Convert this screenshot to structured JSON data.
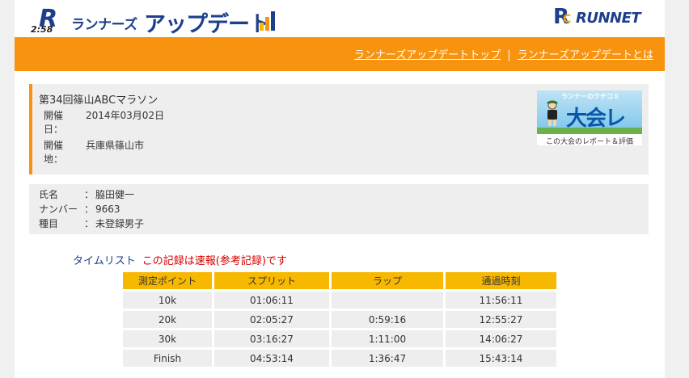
{
  "header": {
    "logo_mark": "R",
    "logo_sub": "2:58",
    "logo_small": "ランナーズ",
    "logo_big": "アップデート",
    "runnet_text": "RUNNET",
    "runnet_mark_r": "R",
    "runnet_mark_c": "C"
  },
  "nav": {
    "top_link": "ランナーズアップデートトップ",
    "separator": "|",
    "about_link": "ランナーズアップデートとは"
  },
  "race": {
    "title": "第34回篠山ABCマラソン",
    "date_label": "開催日：",
    "date_value": "2014年03月02日",
    "place_label": "開催地：",
    "place_value": "兵庫県篠山市",
    "banner_tag": "ランナーのクチコミ",
    "banner_big": "大会レポ",
    "banner_caption": "この大会のレポート＆評価"
  },
  "runner": {
    "name_label": "氏名",
    "name_value": "脇田健一",
    "number_label": "ナンバー",
    "number_value": "9663",
    "category_label": "種目",
    "category_value": "未登録男子",
    "colon": "："
  },
  "timelist": {
    "title": "タイムリスト",
    "notice": "この記録は速報(参考記録)です",
    "headers": [
      "測定ポイント",
      "スプリット",
      "ラップ",
      "通過時刻"
    ],
    "rows": [
      [
        "10k",
        "01:06:11",
        "",
        "11:56:11"
      ],
      [
        "20k",
        "02:05:27",
        "0:59:16",
        "12:55:27"
      ],
      [
        "30k",
        "03:16:27",
        "1:11:00",
        "14:06:27"
      ],
      [
        "Finish",
        "04:53:14",
        "1:36:47",
        "15:43:14"
      ]
    ]
  },
  "colors": {
    "orange": "#f7930f",
    "navy": "#1e3f8c",
    "header_cell": "#f7b800",
    "cell": "#eeeeee",
    "notice_red": "#d40000"
  }
}
